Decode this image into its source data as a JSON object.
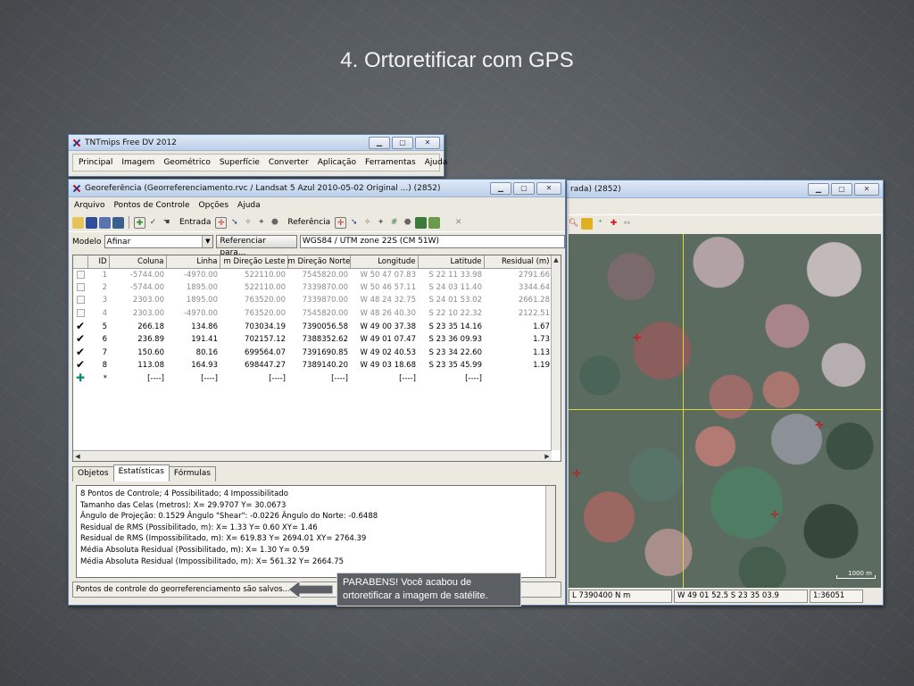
{
  "slide": {
    "title": "4. Ortoretificar com GPS"
  },
  "tnt_window": {
    "title": "TNTmips Free DV 2012",
    "menu": [
      "Principal",
      "Imagem",
      "Geométrico",
      "Superfície",
      "Converter",
      "Aplicação",
      "Ferramentas",
      "Ajuda"
    ]
  },
  "geo_window": {
    "title": "Georeferência (Georreferenciamento.rvc / Landsat 5 Azul 2010-05-02 Original ...) (2852)",
    "menu": [
      "Arquivo",
      "Pontos de Controle",
      "Opções",
      "Ajuda"
    ],
    "toolbar": {
      "input_label": "Entrada",
      "reference_label": "Referência"
    },
    "model_label": "Modelo",
    "model_value": "Afinar",
    "reference_button": "Referenciar para...",
    "projection": "WGS84 / UTM zone 22S (CM 51W)",
    "table": {
      "headers": [
        "ID",
        "Coluna",
        "Linha",
        "m Direção Leste",
        "m Direção Norte",
        "Longitude",
        "Latitude",
        "Residual (m)"
      ],
      "rows": [
        {
          "active": false,
          "cells": [
            "1",
            "-5744.00",
            "-4970.00",
            "522110.00",
            "7545820.00",
            "W 50 47 07.83",
            "S 22 11 33.98",
            "2791.66"
          ]
        },
        {
          "active": false,
          "cells": [
            "2",
            "-5744.00",
            "1895.00",
            "522110.00",
            "7339870.00",
            "W 50 46 57.11",
            "S 24 03 11.40",
            "3344.64"
          ]
        },
        {
          "active": false,
          "cells": [
            "3",
            "2303.00",
            "1895.00",
            "763520.00",
            "7339870.00",
            "W 48 24 32.75",
            "S 24 01 53.02",
            "2661.28"
          ]
        },
        {
          "active": false,
          "cells": [
            "4",
            "2303.00",
            "-4970.00",
            "763520.00",
            "7545820.00",
            "W 48 26 40.30",
            "S 22 10 22.32",
            "2122.51"
          ]
        },
        {
          "active": true,
          "cells": [
            "5",
            "266.18",
            "134.86",
            "703034.19",
            "7390056.58",
            "W 49 00 37.38",
            "S 23 35 14.16",
            "1.67"
          ]
        },
        {
          "active": true,
          "cells": [
            "6",
            "236.89",
            "191.41",
            "702157.12",
            "7388352.62",
            "W 49 01 07.47",
            "S 23 36 09.93",
            "1.73"
          ]
        },
        {
          "active": true,
          "cells": [
            "7",
            "150.60",
            "80.16",
            "699564.07",
            "7391690.85",
            "W 49 02 40.53",
            "S 23 34 22.60",
            "1.13"
          ]
        },
        {
          "active": true,
          "cells": [
            "8",
            "113.08",
            "164.93",
            "698447.27",
            "7389140.20",
            "W 49 03 18.68",
            "S 23 35 45.99",
            "1.19"
          ]
        }
      ],
      "new_row": [
        "*",
        "[----]",
        "[----]",
        "[----]",
        "[----]",
        "[----]",
        "[----]",
        ""
      ]
    },
    "tabs": [
      "Objetos",
      "Estatísticas",
      "Fórmulas"
    ],
    "report_lines": [
      "8 Pontos de Controle;  4 Possibilitado;  4 Impossibilitado",
      "Tamanho das Celas (metros):  X= 29.9707  Y= 30.0673",
      "Ângulo de Projeção: 0.1529  Ângulo \"Shear\": -0.0226  Ângulo do Norte: -0.6488",
      "Residual de RMS (Possibilitado, m):  X= 1.33  Y= 0.60  XY= 1.46",
      "Residual de RMS (Impossibilitado, m):  X= 619.83  Y= 2694.01  XY= 2764.39",
      "Média Absoluta Residual (Possibilitado, m):  X= 1.30  Y= 0.59",
      "Média Absoluta Residual (Impossibilitado, m):  X= 561.32  Y= 2664.75"
    ],
    "status": "Pontos de controle do georreferenciamento são salvos..."
  },
  "view_window": {
    "title": "rada) (2852)",
    "scale_label": "1000 m",
    "status": [
      "L  7390400 N m",
      "W 49 01 52.5  S 23 35 03.9",
      "1:36051"
    ]
  },
  "callout": {
    "text": "PARABENS! Você acabou de ortoretificar a imagem de satélite."
  },
  "colors": {
    "title_gradient_top": "#dfe9f7",
    "crosshair": "#e0d832",
    "gcp_marker": "#d01010",
    "callout_bg": "#5c6064"
  }
}
